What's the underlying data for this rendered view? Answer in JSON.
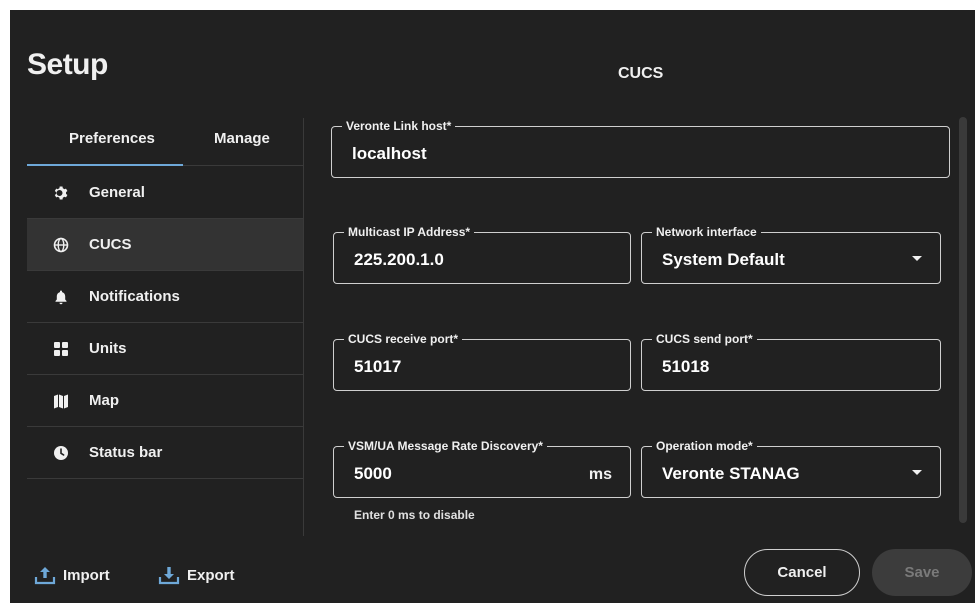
{
  "header": {
    "title": "Setup",
    "section_title": "CUCS"
  },
  "tabs": [
    {
      "label": "Preferences",
      "active": true
    },
    {
      "label": "Manage",
      "active": false
    }
  ],
  "sidebar": {
    "items": [
      {
        "label": "General",
        "icon": "gear-icon",
        "active": false
      },
      {
        "label": "CUCS",
        "icon": "globe-icon",
        "active": true
      },
      {
        "label": "Notifications",
        "icon": "bell-icon",
        "active": false
      },
      {
        "label": "Units",
        "icon": "grid-icon",
        "active": false
      },
      {
        "label": "Map",
        "icon": "map-icon",
        "active": false
      },
      {
        "label": "Status bar",
        "icon": "clock-icon",
        "active": false
      }
    ]
  },
  "form": {
    "link_host": {
      "label": "Veronte Link host*",
      "value": "localhost"
    },
    "multicast_ip": {
      "label": "Multicast IP Address*",
      "value": "225.200.1.0"
    },
    "network_interface": {
      "label": "Network interface",
      "value": "System Default"
    },
    "receive_port": {
      "label": "CUCS receive port*",
      "value": "51017"
    },
    "send_port": {
      "label": "CUCS send port*",
      "value": "51018"
    },
    "rate_discovery": {
      "label": "VSM/UA Message Rate Discovery*",
      "value": "5000",
      "suffix": "ms",
      "helper": "Enter 0 ms to disable"
    },
    "operation_mode": {
      "label": "Operation mode*",
      "value": "Veronte STANAG"
    }
  },
  "footer": {
    "import_label": "Import",
    "export_label": "Export",
    "cancel_label": "Cancel",
    "save_label": "Save"
  },
  "colors": {
    "background": "#212121",
    "accent": "#6ea8d8",
    "active_row": "#333333"
  }
}
